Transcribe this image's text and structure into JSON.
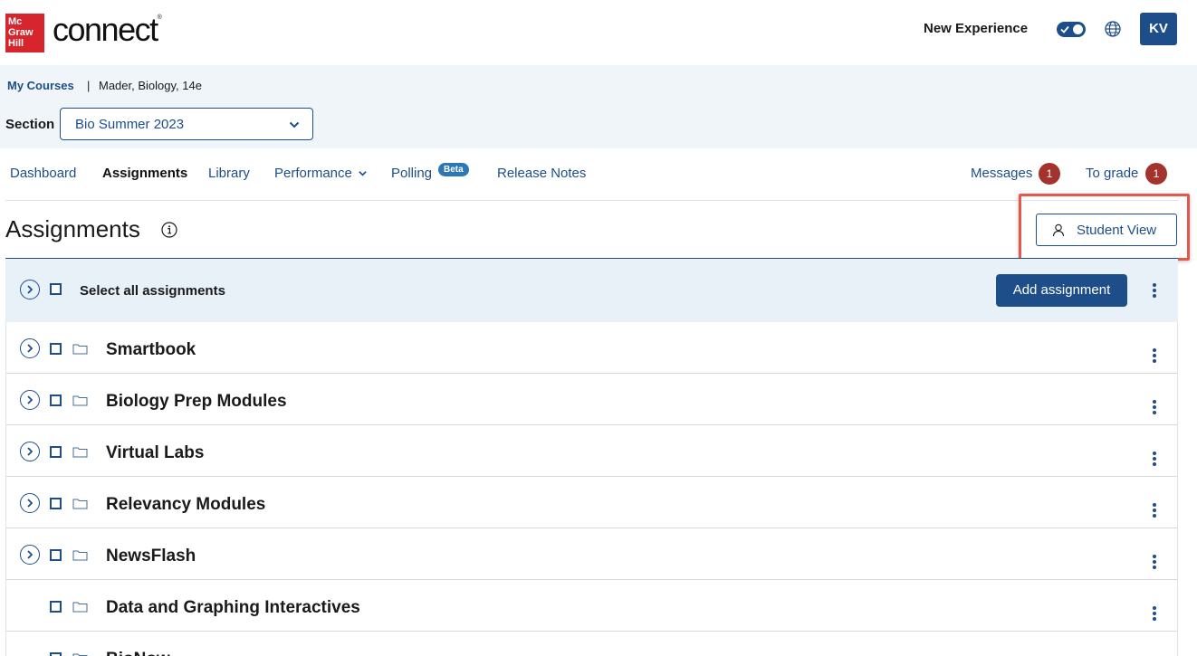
{
  "header": {
    "logo_lines": [
      "Mc",
      "Graw",
      "Hill"
    ],
    "brand": "connect",
    "brand_mark": "®",
    "new_experience_label": "New Experience",
    "toggle_on": true,
    "avatar_initials": "KV",
    "icons": {
      "globe": "globe-icon",
      "check": "check-icon"
    }
  },
  "breadcrumb": {
    "link": "My Courses",
    "separator": "|",
    "current": "Mader, Biology, 14e"
  },
  "section": {
    "label": "Section",
    "selected": "Bio Summer 2023"
  },
  "nav": {
    "items": [
      {
        "label": "Dashboard",
        "active": false
      },
      {
        "label": "Assignments",
        "active": true
      },
      {
        "label": "Library",
        "active": false
      },
      {
        "label": "Performance",
        "active": false,
        "dropdown": true
      },
      {
        "label": "Polling",
        "active": false,
        "badge": "Beta"
      },
      {
        "label": "Release Notes",
        "active": false
      }
    ],
    "messages_label": "Messages",
    "messages_count": "1",
    "to_grade_label": "To grade",
    "to_grade_count": "1"
  },
  "page": {
    "title": "Assignments",
    "student_view_label": "Student View",
    "select_all_label": "Select all assignments",
    "add_assignment_label": "Add assignment"
  },
  "folders": [
    {
      "name": "Smartbook",
      "expandable": true
    },
    {
      "name": "Biology Prep Modules",
      "expandable": true
    },
    {
      "name": "Virtual Labs",
      "expandable": true
    },
    {
      "name": "Relevancy Modules",
      "expandable": true
    },
    {
      "name": "NewsFlash",
      "expandable": true
    },
    {
      "name": "Data and Graphing Interactives",
      "expandable": false
    },
    {
      "name": "BioNow",
      "expandable": false
    }
  ],
  "colors": {
    "brand_red": "#d6252d",
    "primary_blue": "#1d4e89",
    "band_blue": "#f0f5fa",
    "badge_red": "#a3332c",
    "highlight_red": "#e4574d"
  }
}
